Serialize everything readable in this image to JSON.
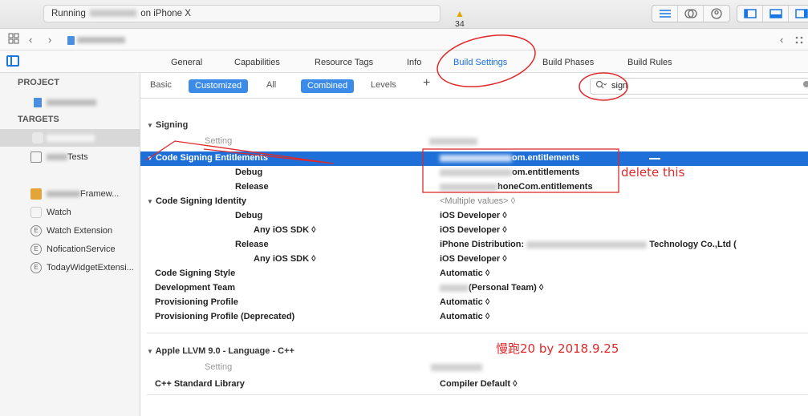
{
  "toolbar": {
    "running_prefix": "Running",
    "running_suffix": "on iPhone X",
    "warning_count": "34"
  },
  "tabs": [
    {
      "label": "General"
    },
    {
      "label": "Capabilities"
    },
    {
      "label": "Resource Tags"
    },
    {
      "label": "Info"
    },
    {
      "label": "Build Settings"
    },
    {
      "label": "Build Phases"
    },
    {
      "label": "Build Rules"
    }
  ],
  "sidebar": {
    "project_header": "PROJECT",
    "targets_header": "TARGETS",
    "targets": [
      {
        "label": "Tests",
        "icon": "test-bundle-icon"
      },
      {
        "label": "Framew...",
        "icon": "framework-icon"
      },
      {
        "label": "Watch",
        "icon": "watch-app-icon"
      },
      {
        "label": "Watch Extension",
        "icon": "extension-icon"
      },
      {
        "label": "NoficationService",
        "icon": "extension-icon"
      },
      {
        "label": "TodayWidgetExtensi...",
        "icon": "extension-icon"
      }
    ]
  },
  "filters": {
    "basic": "Basic",
    "customized": "Customized",
    "all": "All",
    "combined": "Combined",
    "levels": "Levels",
    "add": "+",
    "search_value": "sign"
  },
  "signing": {
    "title": "Signing",
    "setting_header": "Setting",
    "entitlements_key": "Code Signing Entitlements",
    "entitlements_value": "om.entitlements",
    "debug_key": "Debug",
    "debug_value": "om.entitlements",
    "release_key": "Release",
    "release_value": "honeCom.entitlements",
    "identity_key": "Code Signing Identity",
    "identity_value": "<Multiple values> ◊",
    "id_debug_key": "Debug",
    "id_debug_value": "iOS Developer ◊",
    "id_debug_sdk_key": "Any iOS SDK ◊",
    "id_debug_sdk_value": "iOS Developer ◊",
    "id_release_key": "Release",
    "id_release_value": "iPhone Distribution:",
    "id_release_value_tail": "Technology Co.,Ltd (",
    "id_release_sdk_key": "Any iOS SDK ◊",
    "id_release_sdk_value": "iOS Developer ◊",
    "style_key": "Code Signing Style",
    "style_value": "Automatic ◊",
    "team_key": "Development Team",
    "team_value": "(Personal Team) ◊",
    "profile_key": "Provisioning Profile",
    "profile_value": "Automatic ◊",
    "profile_dep_key": "Provisioning Profile (Deprecated)",
    "profile_dep_value": "Automatic ◊"
  },
  "llvm": {
    "title": "Apple LLVM 9.0 - Language - C++",
    "setting_header": "Setting",
    "cpp_key": "C++ Standard Library",
    "cpp_value": "Compiler Default ◊"
  },
  "annotations": {
    "delete_note": "delete this",
    "watermark": "慢跑20 by 2018.9.25",
    "color": "#e0282a"
  },
  "colors": {
    "accent": "#1e70d8",
    "pill": "#3d8be8"
  }
}
